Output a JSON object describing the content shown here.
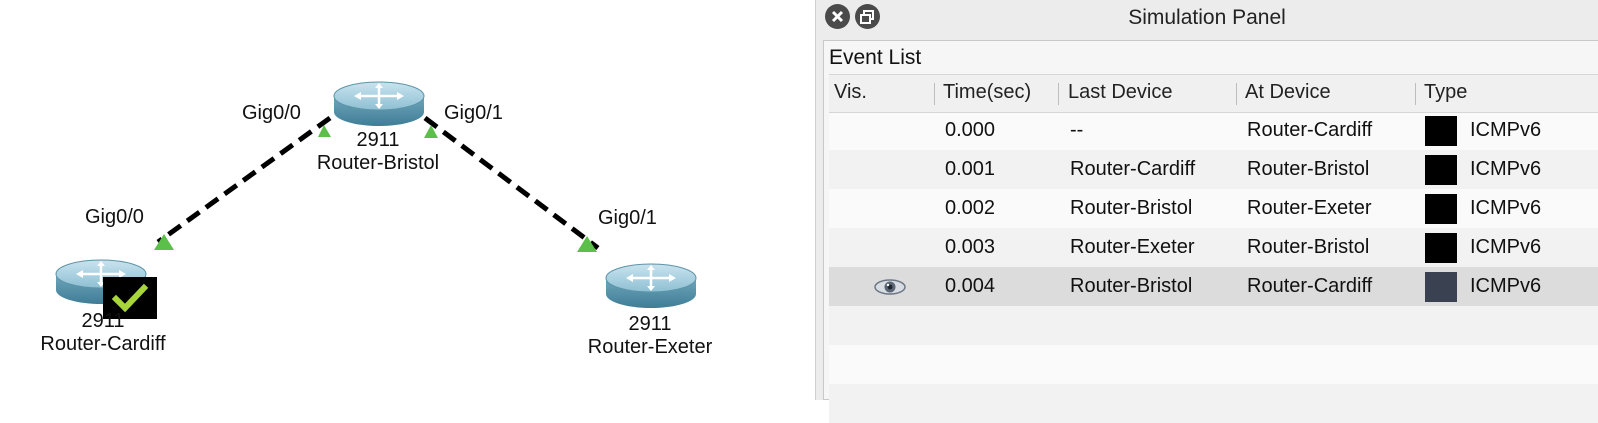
{
  "topology": {
    "devices": [
      {
        "id": "bristol",
        "model": "2911",
        "name": "Router-Bristol"
      },
      {
        "id": "cardiff",
        "model": "2911",
        "name": "Router-Cardiff"
      },
      {
        "id": "exeter",
        "model": "2911",
        "name": "Router-Exeter"
      }
    ],
    "ports": {
      "bristol_left": "Gig0/0",
      "bristol_right": "Gig0/1",
      "cardiff": "Gig0/0",
      "exeter": "Gig0/1"
    },
    "colors": {
      "link": "#000000",
      "port_up": "#5cbf4a",
      "router_body": "#7fb3c7",
      "pdu_check": "#a8d63a"
    }
  },
  "panel": {
    "title": "Simulation Panel",
    "event_list_label": "Event List",
    "columns": [
      "Vis.",
      "Time(sec)",
      "Last Device",
      "At Device",
      "Type"
    ],
    "rows": [
      {
        "vis": "",
        "time": "0.000",
        "last": "--",
        "at": "Router-Cardiff",
        "type": "ICMPv6",
        "color": "#000000"
      },
      {
        "vis": "",
        "time": "0.001",
        "last": "Router-Cardiff",
        "at": "Router-Bristol",
        "type": "ICMPv6",
        "color": "#000000"
      },
      {
        "vis": "",
        "time": "0.002",
        "last": "Router-Bristol",
        "at": "Router-Exeter",
        "type": "ICMPv6",
        "color": "#000000"
      },
      {
        "vis": "",
        "time": "0.003",
        "last": "Router-Exeter",
        "at": "Router-Bristol",
        "type": "ICMPv6",
        "color": "#000000"
      },
      {
        "vis": "eye-icon",
        "time": "0.004",
        "last": "Router-Bristol",
        "at": "Router-Cardiff",
        "type": "ICMPv6",
        "color": "#3a4150"
      }
    ]
  }
}
